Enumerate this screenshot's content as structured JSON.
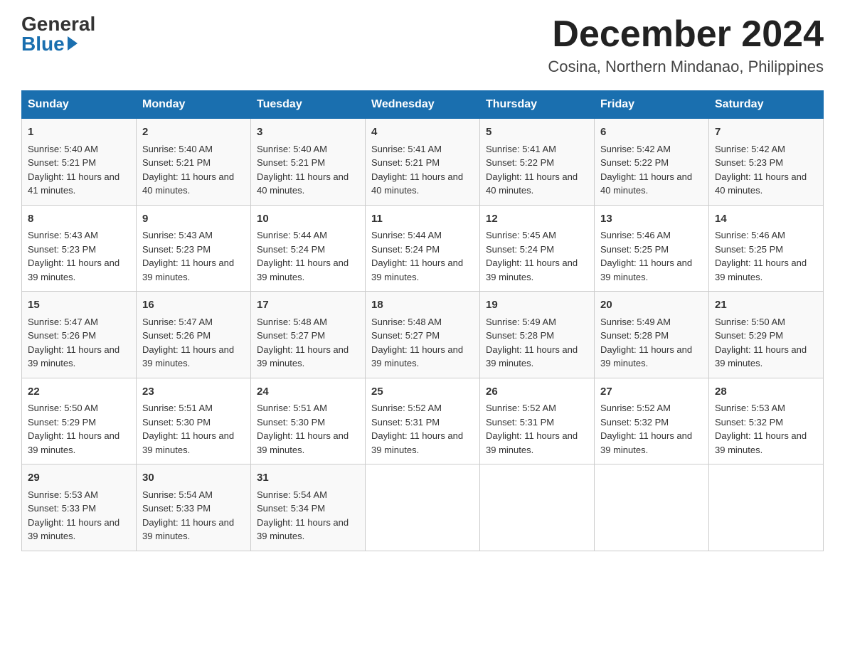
{
  "logo": {
    "general": "General",
    "blue": "Blue"
  },
  "title": "December 2024",
  "location": "Cosina, Northern Mindanao, Philippines",
  "days_header": [
    "Sunday",
    "Monday",
    "Tuesday",
    "Wednesday",
    "Thursday",
    "Friday",
    "Saturday"
  ],
  "weeks": [
    [
      {
        "day": "1",
        "sunrise": "5:40 AM",
        "sunset": "5:21 PM",
        "daylight": "11 hours and 41 minutes."
      },
      {
        "day": "2",
        "sunrise": "5:40 AM",
        "sunset": "5:21 PM",
        "daylight": "11 hours and 40 minutes."
      },
      {
        "day": "3",
        "sunrise": "5:40 AM",
        "sunset": "5:21 PM",
        "daylight": "11 hours and 40 minutes."
      },
      {
        "day": "4",
        "sunrise": "5:41 AM",
        "sunset": "5:21 PM",
        "daylight": "11 hours and 40 minutes."
      },
      {
        "day": "5",
        "sunrise": "5:41 AM",
        "sunset": "5:22 PM",
        "daylight": "11 hours and 40 minutes."
      },
      {
        "day": "6",
        "sunrise": "5:42 AM",
        "sunset": "5:22 PM",
        "daylight": "11 hours and 40 minutes."
      },
      {
        "day": "7",
        "sunrise": "5:42 AM",
        "sunset": "5:23 PM",
        "daylight": "11 hours and 40 minutes."
      }
    ],
    [
      {
        "day": "8",
        "sunrise": "5:43 AM",
        "sunset": "5:23 PM",
        "daylight": "11 hours and 39 minutes."
      },
      {
        "day": "9",
        "sunrise": "5:43 AM",
        "sunset": "5:23 PM",
        "daylight": "11 hours and 39 minutes."
      },
      {
        "day": "10",
        "sunrise": "5:44 AM",
        "sunset": "5:24 PM",
        "daylight": "11 hours and 39 minutes."
      },
      {
        "day": "11",
        "sunrise": "5:44 AM",
        "sunset": "5:24 PM",
        "daylight": "11 hours and 39 minutes."
      },
      {
        "day": "12",
        "sunrise": "5:45 AM",
        "sunset": "5:24 PM",
        "daylight": "11 hours and 39 minutes."
      },
      {
        "day": "13",
        "sunrise": "5:46 AM",
        "sunset": "5:25 PM",
        "daylight": "11 hours and 39 minutes."
      },
      {
        "day": "14",
        "sunrise": "5:46 AM",
        "sunset": "5:25 PM",
        "daylight": "11 hours and 39 minutes."
      }
    ],
    [
      {
        "day": "15",
        "sunrise": "5:47 AM",
        "sunset": "5:26 PM",
        "daylight": "11 hours and 39 minutes."
      },
      {
        "day": "16",
        "sunrise": "5:47 AM",
        "sunset": "5:26 PM",
        "daylight": "11 hours and 39 minutes."
      },
      {
        "day": "17",
        "sunrise": "5:48 AM",
        "sunset": "5:27 PM",
        "daylight": "11 hours and 39 minutes."
      },
      {
        "day": "18",
        "sunrise": "5:48 AM",
        "sunset": "5:27 PM",
        "daylight": "11 hours and 39 minutes."
      },
      {
        "day": "19",
        "sunrise": "5:49 AM",
        "sunset": "5:28 PM",
        "daylight": "11 hours and 39 minutes."
      },
      {
        "day": "20",
        "sunrise": "5:49 AM",
        "sunset": "5:28 PM",
        "daylight": "11 hours and 39 minutes."
      },
      {
        "day": "21",
        "sunrise": "5:50 AM",
        "sunset": "5:29 PM",
        "daylight": "11 hours and 39 minutes."
      }
    ],
    [
      {
        "day": "22",
        "sunrise": "5:50 AM",
        "sunset": "5:29 PM",
        "daylight": "11 hours and 39 minutes."
      },
      {
        "day": "23",
        "sunrise": "5:51 AM",
        "sunset": "5:30 PM",
        "daylight": "11 hours and 39 minutes."
      },
      {
        "day": "24",
        "sunrise": "5:51 AM",
        "sunset": "5:30 PM",
        "daylight": "11 hours and 39 minutes."
      },
      {
        "day": "25",
        "sunrise": "5:52 AM",
        "sunset": "5:31 PM",
        "daylight": "11 hours and 39 minutes."
      },
      {
        "day": "26",
        "sunrise": "5:52 AM",
        "sunset": "5:31 PM",
        "daylight": "11 hours and 39 minutes."
      },
      {
        "day": "27",
        "sunrise": "5:52 AM",
        "sunset": "5:32 PM",
        "daylight": "11 hours and 39 minutes."
      },
      {
        "day": "28",
        "sunrise": "5:53 AM",
        "sunset": "5:32 PM",
        "daylight": "11 hours and 39 minutes."
      }
    ],
    [
      {
        "day": "29",
        "sunrise": "5:53 AM",
        "sunset": "5:33 PM",
        "daylight": "11 hours and 39 minutes."
      },
      {
        "day": "30",
        "sunrise": "5:54 AM",
        "sunset": "5:33 PM",
        "daylight": "11 hours and 39 minutes."
      },
      {
        "day": "31",
        "sunrise": "5:54 AM",
        "sunset": "5:34 PM",
        "daylight": "11 hours and 39 minutes."
      },
      null,
      null,
      null,
      null
    ]
  ]
}
